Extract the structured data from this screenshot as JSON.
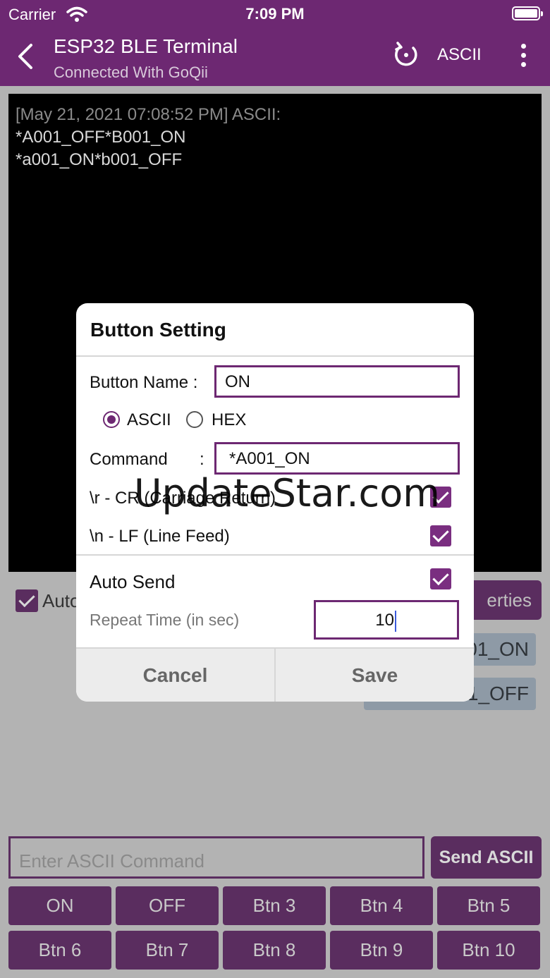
{
  "status_bar": {
    "carrier": "Carrier",
    "time": "7:09 PM"
  },
  "nav": {
    "title": "ESP32 BLE Terminal",
    "subtitle": "Connected With GoQii",
    "mode_label": "ASCII"
  },
  "terminal": {
    "timestamp_line": "[May 21, 2021 07:08:52 PM] ASCII:",
    "lines": [
      "*A001_OFF*B001_ON",
      "*a001_ON*b001_OFF"
    ]
  },
  "behind": {
    "auto_label": "Auto",
    "properties_label": "erties",
    "chip1": "01_ON",
    "chip2": "01_OFF"
  },
  "dialog": {
    "title": "Button Setting",
    "button_name_label": "Button Name :",
    "button_name_value": "ON",
    "radio_ascii": "ASCII",
    "radio_hex": "HEX",
    "command_label": "Command",
    "command_colon": ":",
    "command_value": "*A001_ON",
    "cr_label": "\\r - CR (Carriage Return)",
    "lf_label": "\\n - LF (Line Feed)",
    "auto_send_label": "Auto Send",
    "repeat_label": "Repeat Time (in sec)",
    "repeat_value": "10",
    "cancel_label": "Cancel",
    "save_label": "Save"
  },
  "bottom": {
    "input_placeholder": "Enter ASCII Command",
    "send_label": "Send ASCII",
    "buttons": [
      "ON",
      "OFF",
      "Btn 3",
      "Btn 4",
      "Btn 5",
      "Btn 6",
      "Btn 7",
      "Btn 8",
      "Btn 9",
      "Btn 10"
    ]
  },
  "watermark": "UpdateStar.com",
  "colors": {
    "primary": "#6d2872",
    "overlay_bg": "#b3b3b3",
    "terminal_bg": "#000000"
  }
}
